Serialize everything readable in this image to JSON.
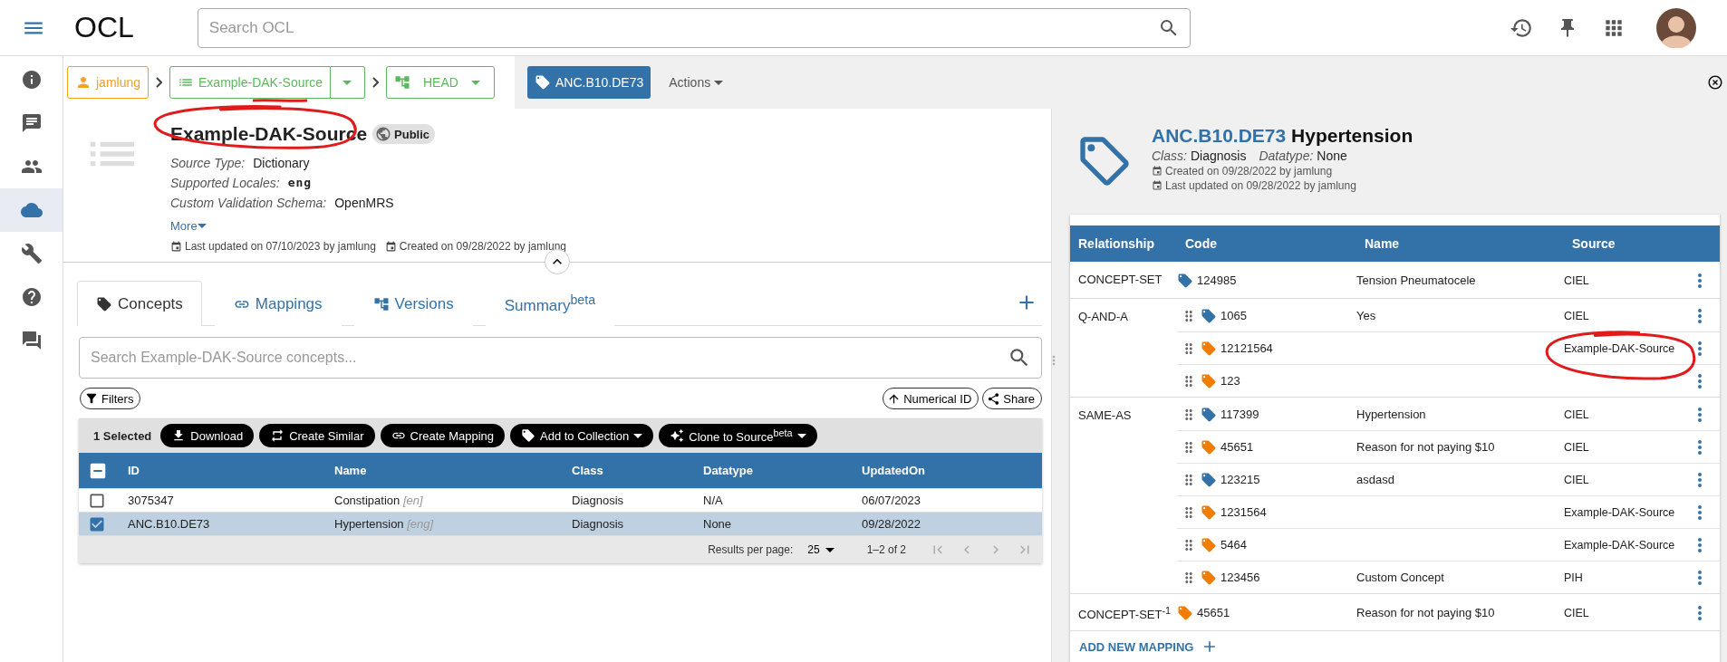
{
  "topbar": {
    "app_name": "OCL",
    "search": {
      "placeholder": "Search OCL"
    }
  },
  "sidebar": {
    "items": [
      {
        "kind": "info",
        "selected": false
      },
      {
        "kind": "chat",
        "selected": false
      },
      {
        "kind": "people",
        "selected": false
      },
      {
        "kind": "cloud",
        "selected": true
      },
      {
        "kind": "tools",
        "selected": false
      },
      {
        "kind": "help",
        "selected": false
      },
      {
        "kind": "forum",
        "selected": false
      }
    ]
  },
  "breadcrumbs": {
    "owner": "jamlung",
    "source": {
      "label": "Example-DAK-Source",
      "underlined": true
    },
    "version": "HEAD",
    "concept": "ANC.B10.DE73",
    "actions": "Actions"
  },
  "source": {
    "title": "Example-DAK-Source",
    "circled": true,
    "visibility": "Public",
    "fields": [
      {
        "label": "Source Type:",
        "value": "Dictionary",
        "kind": "text"
      },
      {
        "label": "Supported Locales:",
        "value": "eng",
        "kind": "code"
      },
      {
        "label": "Custom Validation Schema:",
        "value": "OpenMRS",
        "kind": "text"
      }
    ],
    "more": "More",
    "updated": "Last updated on 07/10/2023 by jamlung",
    "created": "Created on 09/28/2022 by jamlung"
  },
  "tabs": [
    {
      "label": "Concepts",
      "kind": "concepts",
      "selected": true
    },
    {
      "label": "Mappings",
      "kind": "mappings",
      "selected": false
    },
    {
      "label": "Versions",
      "kind": "versions",
      "selected": false
    },
    {
      "label": "Summary$^{beta}$",
      "kind": "summary",
      "selected": false
    }
  ],
  "search": {
    "placeholder": "Search Example-DAK-Source concepts..."
  },
  "filters": "Filters",
  "sort": "Numerical ID",
  "share": "Share",
  "selection": {
    "count": "1 Selected",
    "actions": [
      {
        "label": "Download",
        "kind": "download",
        "menu": false
      },
      {
        "label": "Create Similar",
        "kind": "similar",
        "menu": false
      },
      {
        "label": "Create Mapping",
        "kind": "mapping",
        "menu": false
      },
      {
        "label": "Add to Collection",
        "kind": "collection",
        "menu": true
      },
      {
        "label": "Clone to Source$^{beta}$",
        "kind": "clone",
        "menu": true
      }
    ]
  },
  "table": {
    "select_all_partial": true,
    "columns": [
      "ID",
      "Name",
      "Class",
      "Datatype",
      "UpdatedOn"
    ],
    "rows": [
      {
        "selected": false,
        "id": "3075347",
        "name": "Constipation",
        "locale": "[en]",
        "class": "Diagnosis",
        "datatype": "N/A",
        "updated": "06/07/2023"
      },
      {
        "selected": true,
        "id": "ANC.B10.DE73",
        "name": "Hypertension",
        "locale": "[eng]",
        "class": "Diagnosis",
        "datatype": "None",
        "updated": "09/28/2022"
      }
    ]
  },
  "pagination": {
    "label": "Results per page:",
    "per_page": "25",
    "range": "1–2 of 2"
  },
  "concept": {
    "id": "ANC.B10.DE73",
    "name": "Hypertension",
    "class_label": "Class:",
    "class": "Diagnosis",
    "datatype_label": "Datatype:",
    "datatype": "None",
    "created": "Created on 09/28/2022 by jamlung",
    "updated": "Last updated on 09/28/2022 by jamlung"
  },
  "associations": {
    "columns": [
      "Relationship",
      "Code",
      "Name",
      "Source"
    ],
    "groups": [
      {
        "relationship": "CONCEPT-SET",
        "draggable": false,
        "mappings": [
          {
            "code": "124985",
            "color": "#3372a8",
            "name": "Tension Pneumatocele",
            "source": "CIEL"
          }
        ]
      },
      {
        "relationship": "Q-AND-A",
        "draggable": true,
        "mappings": [
          {
            "code": "1065",
            "color": "#3372a8",
            "name": "Yes",
            "source": "CIEL"
          },
          {
            "code": "12121564",
            "color": "#f07c00",
            "source": "Example-DAK-Source",
            "circled": true
          },
          {
            "code": "123",
            "color": "#f07c00"
          }
        ]
      },
      {
        "relationship": "SAME-AS",
        "draggable": true,
        "mappings": [
          {
            "code": "117399",
            "color": "#3372a8",
            "name": "Hypertension",
            "source": "CIEL"
          },
          {
            "code": "45651",
            "color": "#f07c00",
            "name": "Reason for not paying $10",
            "source": "CIEL"
          },
          {
            "code": "123215",
            "color": "#3372a8",
            "name": "asdasd",
            "source": "CIEL"
          },
          {
            "code": "1231564",
            "color": "#f07c00",
            "source": "Example-DAK-Source"
          },
          {
            "code": "5464",
            "color": "#f07c00",
            "source": "Example-DAK-Source"
          },
          {
            "code": "123456",
            "color": "#f07c00",
            "name": "Custom Concept",
            "source": "PIH"
          }
        ]
      },
      {
        "relationship": "CONCEPT-SET$^{-1}$",
        "draggable": false,
        "mappings": [
          {
            "code": "45651",
            "color": "#f07c00",
            "name": "Reason for not paying $10",
            "source": "CIEL"
          }
        ]
      }
    ],
    "add": "ADD NEW MAPPING"
  }
}
